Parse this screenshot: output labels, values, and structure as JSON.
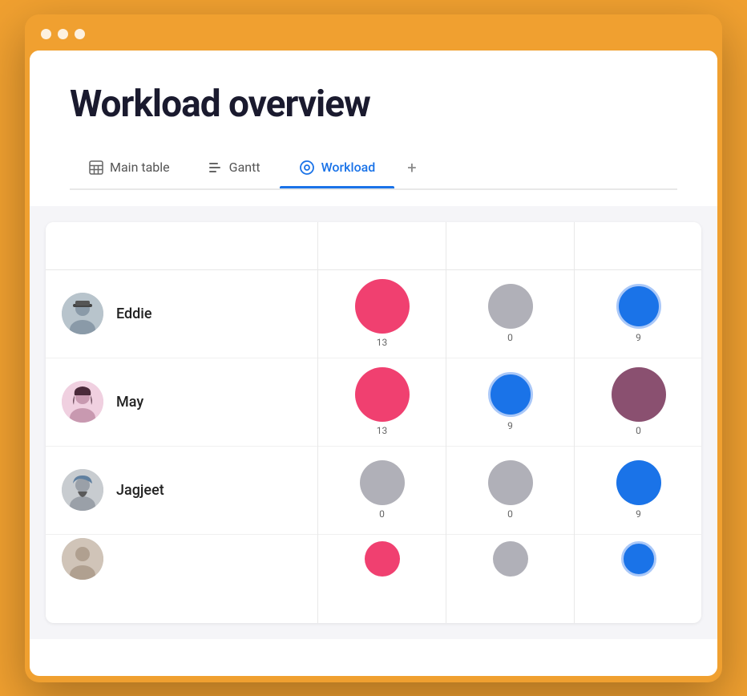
{
  "window": {
    "title": "Workload overview"
  },
  "header": {
    "title": "Workload overview"
  },
  "tabs": [
    {
      "id": "main-table",
      "label": "Main table",
      "icon": "table-icon",
      "active": false
    },
    {
      "id": "gantt",
      "label": "Gantt",
      "icon": "gantt-icon",
      "active": false
    },
    {
      "id": "workload",
      "label": "Workload",
      "icon": "workload-icon",
      "active": true
    },
    {
      "id": "add",
      "label": "+",
      "icon": null,
      "active": false
    }
  ],
  "people": [
    {
      "id": "eddie",
      "name": "Eddie"
    },
    {
      "id": "may",
      "name": "May"
    },
    {
      "id": "jagjeet",
      "name": "Jagjeet"
    },
    {
      "id": "fourth",
      "name": ""
    }
  ],
  "columns": [
    {
      "id": "col1",
      "rows": [
        {
          "type": "pink",
          "size": "large",
          "count": "13"
        },
        {
          "type": "pink",
          "size": "large",
          "count": "13"
        },
        {
          "type": "gray",
          "size": "medium",
          "count": "0"
        },
        {
          "type": "pink",
          "size": "medium",
          "count": ""
        }
      ]
    },
    {
      "id": "col2",
      "rows": [
        {
          "type": "gray",
          "size": "medium",
          "count": "0"
        },
        {
          "type": "blue-outline",
          "size": "medium",
          "count": "9"
        },
        {
          "type": "gray",
          "size": "medium",
          "count": "0"
        },
        {
          "type": "gray",
          "size": "medium",
          "count": ""
        }
      ]
    },
    {
      "id": "col3",
      "rows": [
        {
          "type": "blue-outline",
          "size": "medium",
          "count": "9"
        },
        {
          "type": "mauve",
          "size": "large",
          "count": "0"
        },
        {
          "type": "blue",
          "size": "medium",
          "count": "9"
        },
        {
          "type": "blue-outline",
          "size": "medium",
          "count": ""
        }
      ]
    }
  ],
  "partial_col": {
    "rows": [
      {
        "type": "gray"
      },
      {
        "type": "none"
      },
      {
        "type": "blue"
      },
      {
        "type": "none"
      }
    ]
  }
}
